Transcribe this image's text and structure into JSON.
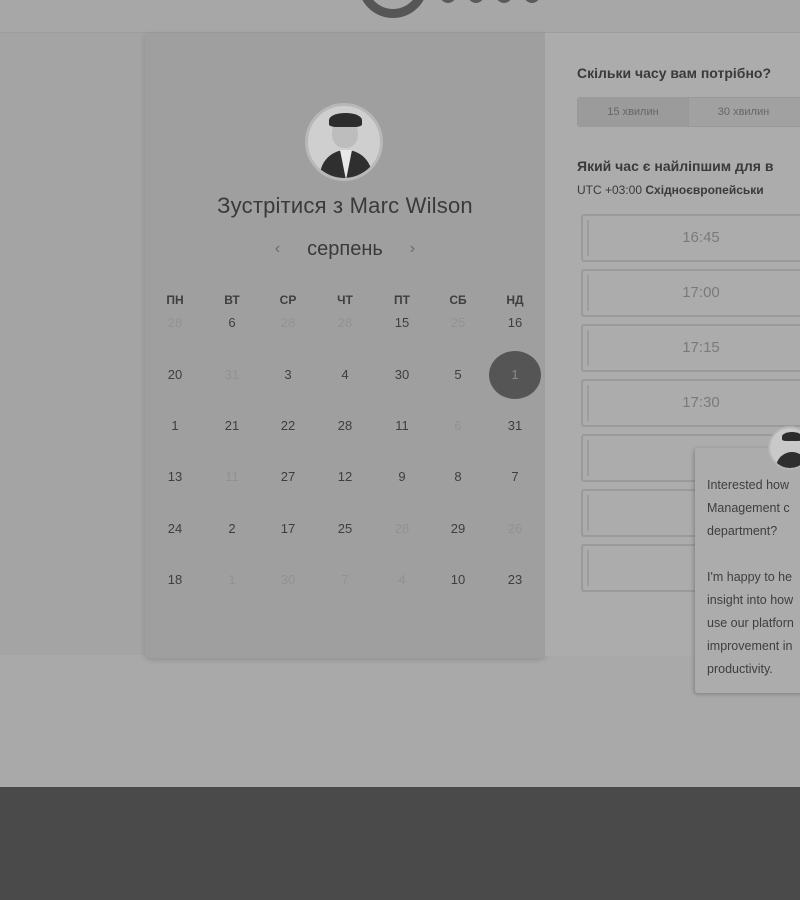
{
  "header": {
    "logo": "logo"
  },
  "organizer": {
    "avatar": "avatar",
    "title": "Зустрітися з Marc Wilson"
  },
  "calendar": {
    "month": "серпень",
    "prev_icon": "‹",
    "next_icon": "›",
    "weekdays": [
      "ПН",
      "ВТ",
      "СР",
      "ЧТ",
      "ПТ",
      "СБ",
      "НД"
    ],
    "weeks": [
      [
        {
          "d": "28",
          "dim": true
        },
        {
          "d": "6",
          "dim": false
        },
        {
          "d": "28",
          "dim": true
        },
        {
          "d": "28",
          "dim": true
        },
        {
          "d": "15",
          "dim": false
        },
        {
          "d": "25",
          "dim": true
        },
        {
          "d": "16",
          "dim": false
        }
      ],
      [
        {
          "d": "20",
          "dim": false
        },
        {
          "d": "31",
          "dim": true
        },
        {
          "d": "3",
          "dim": false
        },
        {
          "d": "4",
          "dim": false
        },
        {
          "d": "30",
          "dim": false
        },
        {
          "d": "5",
          "dim": false
        },
        {
          "d": "1",
          "dim": false,
          "selected": true
        }
      ],
      [
        {
          "d": "1",
          "dim": false
        },
        {
          "d": "21",
          "dim": false
        },
        {
          "d": "22",
          "dim": false
        },
        {
          "d": "28",
          "dim": false
        },
        {
          "d": "11",
          "dim": false
        },
        {
          "d": "6",
          "dim": true
        },
        {
          "d": "31",
          "dim": false
        }
      ],
      [
        {
          "d": "13",
          "dim": false
        },
        {
          "d": "11",
          "dim": true
        },
        {
          "d": "27",
          "dim": false
        },
        {
          "d": "12",
          "dim": false
        },
        {
          "d": "9",
          "dim": false
        },
        {
          "d": "8",
          "dim": false
        },
        {
          "d": "7",
          "dim": false
        }
      ],
      [
        {
          "d": "24",
          "dim": false
        },
        {
          "d": "2",
          "dim": false
        },
        {
          "d": "17",
          "dim": false
        },
        {
          "d": "25",
          "dim": false
        },
        {
          "d": "28",
          "dim": true
        },
        {
          "d": "29",
          "dim": false
        },
        {
          "d": "26",
          "dim": true
        }
      ],
      [
        {
          "d": "18",
          "dim": false
        },
        {
          "d": "1",
          "dim": true
        },
        {
          "d": "30",
          "dim": true
        },
        {
          "d": "7",
          "dim": true
        },
        {
          "d": "4",
          "dim": true
        },
        {
          "d": "10",
          "dim": false
        },
        {
          "d": "23",
          "dim": false
        }
      ]
    ]
  },
  "booking": {
    "duration_question": "Скільки часу вам потрібно?",
    "durations": [
      "15 хвилин",
      "30 хвилин"
    ],
    "time_question": "Який час є найліпшим для в",
    "timezone_prefix": "UTC +03:00",
    "timezone_name": "Східноєвропейськи",
    "slots": [
      "16:45",
      "17:00",
      "17:15",
      "17:30",
      "",
      "",
      ""
    ]
  },
  "chat": {
    "lines": [
      "Interested how",
      "Management c",
      "department?",
      "",
      "I'm happy to he",
      "insight into how",
      "use our platforn",
      "improvement in",
      "productivity."
    ]
  }
}
